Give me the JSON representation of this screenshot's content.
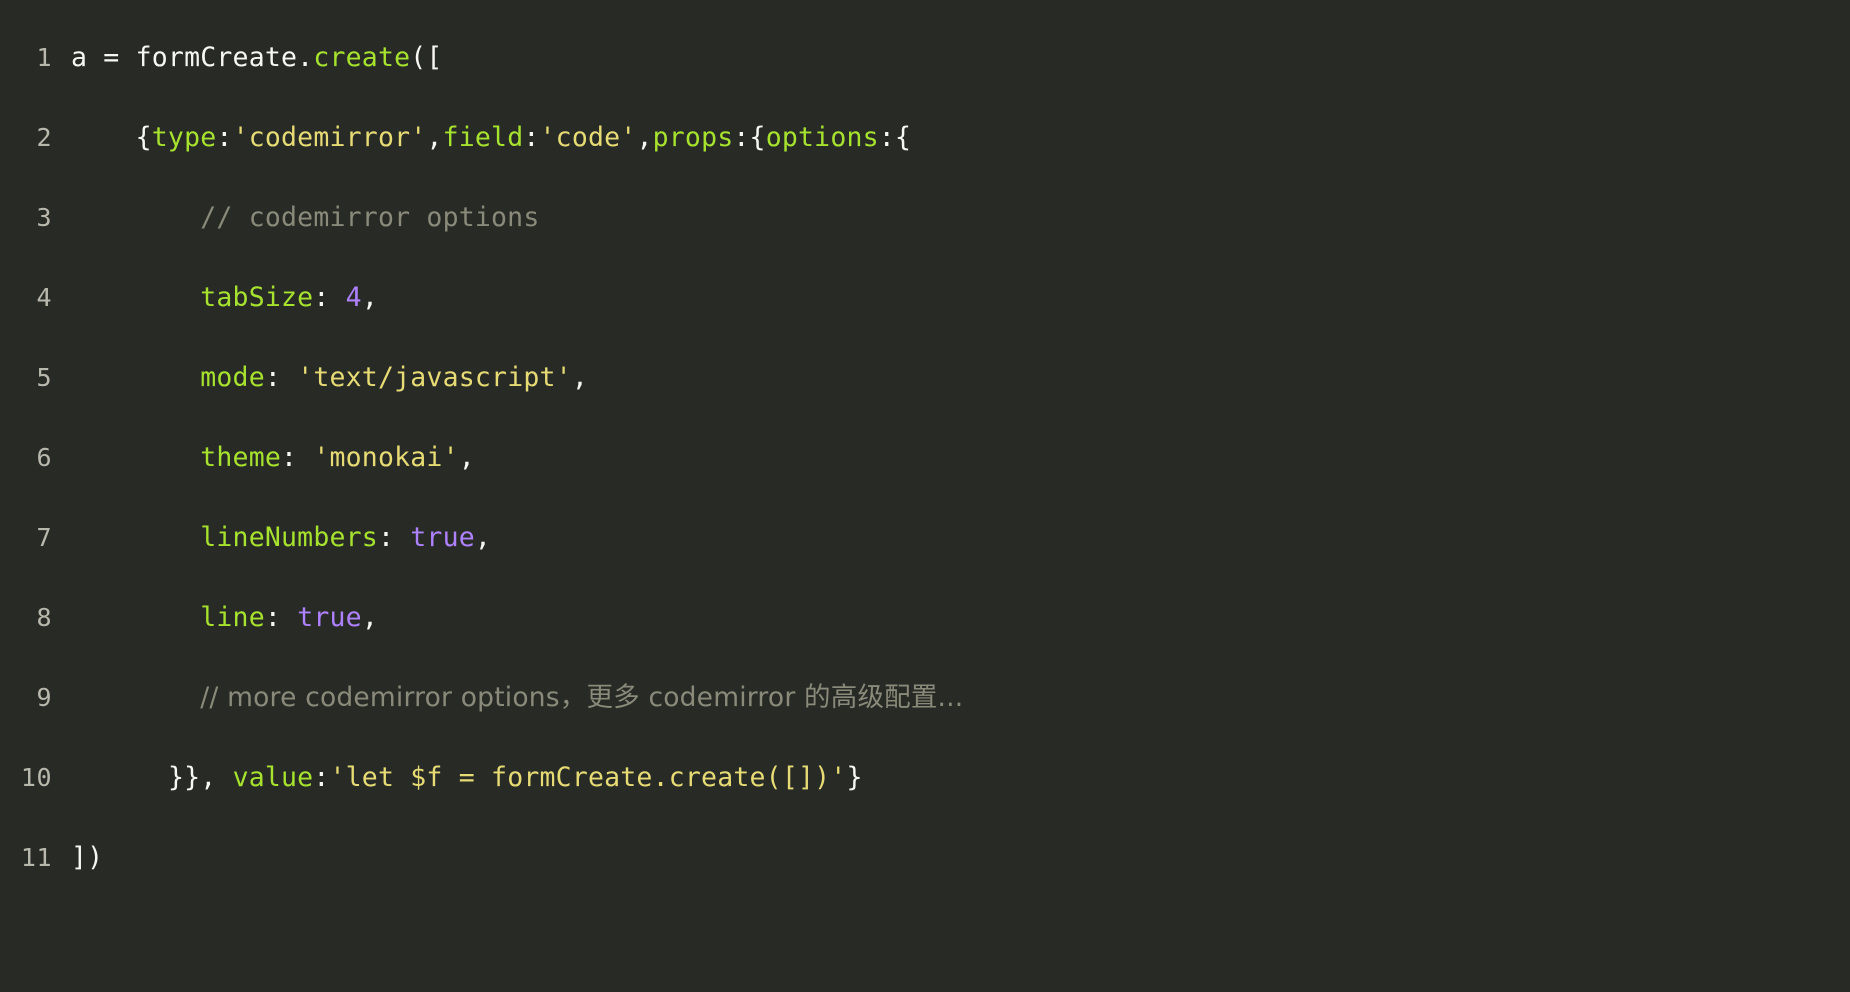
{
  "editor": {
    "theme_name": "monokai",
    "background_color": "#282a26",
    "gutter_color": "#b8b8ad",
    "colors": {
      "plain": "#f8f8f2",
      "key": "#a6e22e",
      "string": "#e6db74",
      "number": "#ae81ff",
      "boolean": "#ae81ff",
      "comment": "#8a8a7a"
    },
    "line_numbers": [
      "1",
      "2",
      "3",
      "4",
      "5",
      "6",
      "7",
      "8",
      "9",
      "10",
      "11"
    ],
    "lines": [
      {
        "number": "1",
        "text": "a = formCreate.create([",
        "tokens": [
          {
            "t": "a = formCreate.",
            "c": "plain"
          },
          {
            "t": "create",
            "c": "fn"
          },
          {
            "t": "([",
            "c": "punct"
          }
        ]
      },
      {
        "number": "2",
        "text": "    {type:'codemirror',field:'code',props:{options:{",
        "tokens": [
          {
            "t": "    ",
            "c": "plain"
          },
          {
            "t": "{",
            "c": "punct"
          },
          {
            "t": "type",
            "c": "key"
          },
          {
            "t": ":",
            "c": "punct"
          },
          {
            "t": "'codemirror'",
            "c": "string"
          },
          {
            "t": ",",
            "c": "punct"
          },
          {
            "t": "field",
            "c": "key"
          },
          {
            "t": ":",
            "c": "punct"
          },
          {
            "t": "'code'",
            "c": "string"
          },
          {
            "t": ",",
            "c": "punct"
          },
          {
            "t": "props",
            "c": "key"
          },
          {
            "t": ":{",
            "c": "punct"
          },
          {
            "t": "options",
            "c": "key"
          },
          {
            "t": ":{",
            "c": "punct"
          }
        ]
      },
      {
        "number": "3",
        "text": "        // codemirror options",
        "tokens": [
          {
            "t": "        ",
            "c": "plain"
          },
          {
            "t": "// codemirror options",
            "c": "comment"
          }
        ]
      },
      {
        "number": "4",
        "text": "        tabSize: 4,",
        "tokens": [
          {
            "t": "        ",
            "c": "plain"
          },
          {
            "t": "tabSize",
            "c": "key"
          },
          {
            "t": ": ",
            "c": "punct"
          },
          {
            "t": "4",
            "c": "number"
          },
          {
            "t": ",",
            "c": "punct"
          }
        ]
      },
      {
        "number": "5",
        "text": "        mode: 'text/javascript',",
        "tokens": [
          {
            "t": "        ",
            "c": "plain"
          },
          {
            "t": "mode",
            "c": "key"
          },
          {
            "t": ": ",
            "c": "punct"
          },
          {
            "t": "'text/javascript'",
            "c": "string"
          },
          {
            "t": ",",
            "c": "punct"
          }
        ]
      },
      {
        "number": "6",
        "text": "        theme: 'monokai',",
        "tokens": [
          {
            "t": "        ",
            "c": "plain"
          },
          {
            "t": "theme",
            "c": "key"
          },
          {
            "t": ": ",
            "c": "punct"
          },
          {
            "t": "'monokai'",
            "c": "string"
          },
          {
            "t": ",",
            "c": "punct"
          }
        ]
      },
      {
        "number": "7",
        "text": "        lineNumbers: true,",
        "tokens": [
          {
            "t": "        ",
            "c": "plain"
          },
          {
            "t": "lineNumbers",
            "c": "key"
          },
          {
            "t": ": ",
            "c": "punct"
          },
          {
            "t": "true",
            "c": "bool"
          },
          {
            "t": ",",
            "c": "punct"
          }
        ]
      },
      {
        "number": "8",
        "text": "        line: true,",
        "tokens": [
          {
            "t": "        ",
            "c": "plain"
          },
          {
            "t": "line",
            "c": "key"
          },
          {
            "t": ": ",
            "c": "punct"
          },
          {
            "t": "true",
            "c": "bool"
          },
          {
            "t": ",",
            "c": "punct"
          }
        ]
      },
      {
        "number": "9",
        "text": "        // more codemirror options，更多 codemirror 的高级配置...",
        "tokens": [
          {
            "t": "        ",
            "c": "plain"
          },
          {
            "t": "// more codemirror options，更多 codemirror 的高级配置...",
            "c": "comment"
          }
        ]
      },
      {
        "number": "10",
        "text": "      }}, value:'let $f = formCreate.create([])'}",
        "tokens": [
          {
            "t": "      ",
            "c": "plain"
          },
          {
            "t": "}}, ",
            "c": "punct"
          },
          {
            "t": "value",
            "c": "key"
          },
          {
            "t": ":",
            "c": "punct"
          },
          {
            "t": "'let $f = formCreate.create([])'",
            "c": "string"
          },
          {
            "t": "}",
            "c": "punct"
          }
        ]
      },
      {
        "number": "11",
        "text": "])",
        "tokens": [
          {
            "t": "])",
            "c": "punct"
          }
        ]
      }
    ]
  }
}
